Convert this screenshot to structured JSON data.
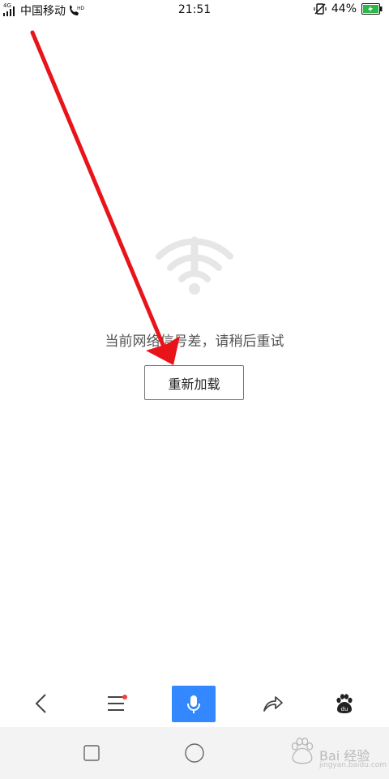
{
  "status_bar": {
    "network_tag": "4G",
    "carrier": "中国移动",
    "time": "21:51",
    "battery": "44%"
  },
  "error": {
    "message": "当前网络信号差，请稍后重试",
    "reload_label": "重新加载"
  },
  "toolbar": {
    "back_icon": "chevron-left-icon",
    "menu_icon": "menu-icon",
    "voice_icon": "microphone-icon",
    "share_icon": "share-arrow-icon",
    "home_icon": "baidu-paw-icon",
    "home_label": "du",
    "voice_color": "#3388ff",
    "notify_color": "#ff3b3b"
  },
  "navbar": {
    "recents_icon": "square-icon",
    "home_icon": "circle-icon"
  },
  "watermark": {
    "text": "Bai 经验",
    "sub": "jingyan.baidu.com"
  },
  "annotation_color": "#e8141a"
}
